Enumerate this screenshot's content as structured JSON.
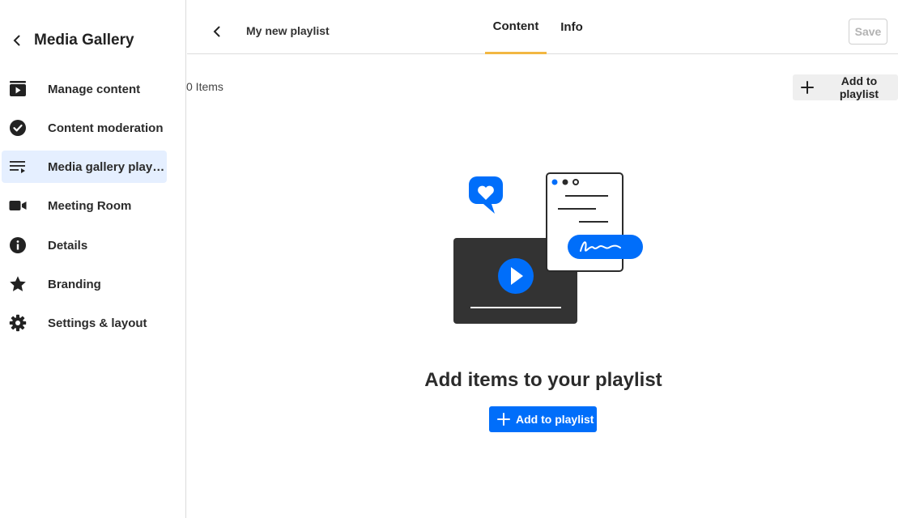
{
  "sidebar": {
    "title": "Media Gallery",
    "back_icon": "chevron-left-icon",
    "items": [
      {
        "label": "Manage content",
        "icon": "play-box-icon",
        "active": false
      },
      {
        "label": "Content moderation",
        "icon": "check-circle-icon",
        "active": false
      },
      {
        "label": "Media gallery playlists",
        "icon": "playlist-icon",
        "active": true
      },
      {
        "label": "Meeting Room",
        "icon": "video-camera-icon",
        "active": false
      },
      {
        "label": "Details",
        "icon": "info-circle-icon",
        "active": false
      },
      {
        "label": "Branding",
        "icon": "star-icon",
        "active": false
      },
      {
        "label": "Settings & layout",
        "icon": "gear-icon",
        "active": false
      }
    ]
  },
  "topbar": {
    "back_icon": "chevron-left-icon",
    "playlist_name": "My new playlist",
    "tabs": [
      {
        "label": "Content",
        "active": true
      },
      {
        "label": "Info",
        "active": false
      }
    ],
    "save_label": "Save"
  },
  "content": {
    "items_count": "0 Items",
    "add_label_top": "Add to playlist",
    "empty_title": "Add items to your playlist",
    "add_label_main": "Add to playlist"
  },
  "colors": {
    "accent": "#006efa",
    "tab_underline": "#f2b742",
    "active_nav_bg": "#e5efff",
    "dark_player": "#333333"
  }
}
